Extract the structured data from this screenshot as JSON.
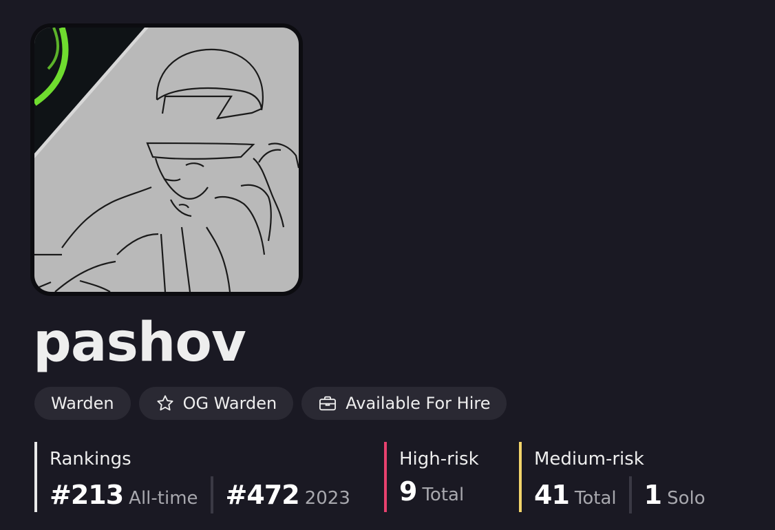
{
  "profile": {
    "username": "pashov",
    "avatar_alt": "avatar"
  },
  "badges": [
    {
      "label": "Warden",
      "icon": null
    },
    {
      "label": "OG Warden",
      "icon": "star-icon"
    },
    {
      "label": "Available For Hire",
      "icon": "briefcase-icon"
    }
  ],
  "stats": {
    "rankings": {
      "title": "Rankings",
      "all_time_value": "#213",
      "all_time_label": "All-time",
      "year_value": "#472",
      "year_label": "2023",
      "accent": "#eaeaea"
    },
    "high_risk": {
      "title": "High-risk",
      "total_value": "9",
      "total_label": "Total",
      "accent": "#e8416e"
    },
    "medium_risk": {
      "title": "Medium-risk",
      "total_value": "41",
      "total_label": "Total",
      "solo_value": "1",
      "solo_label": "Solo",
      "accent": "#f2d46a"
    }
  },
  "colors": {
    "background": "#1a1923",
    "badge_bg": "#2a2933",
    "accent_green": "#6fdc2f"
  }
}
